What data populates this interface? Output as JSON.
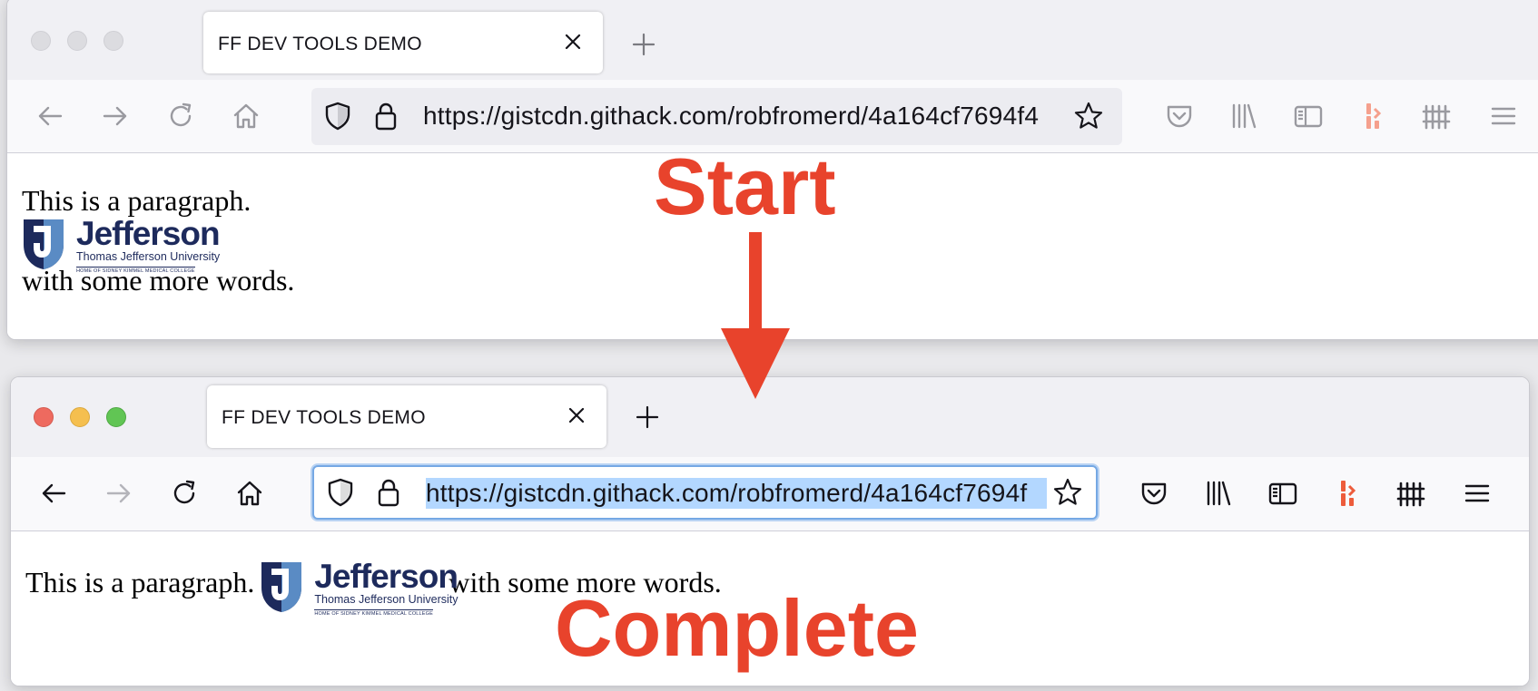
{
  "top_window": {
    "tab_title": "FF DEV TOOLS DEMO",
    "url": "https://gistcdn.githack.com/robfromerd/4a164cf7694f4",
    "paragraph_start": "This is a paragraph.",
    "paragraph_end": "with some more words."
  },
  "bottom_window": {
    "tab_title": "FF DEV TOOLS DEMO",
    "url": "https://gistcdn.githack.com/robfromerd/4a164cf7694f",
    "paragraph_start": "This is a paragraph.",
    "paragraph_end": "with some more words."
  },
  "logo": {
    "name": "Jefferson",
    "subtitle": "Thomas Jefferson University",
    "tagline": "HOME OF SIDNEY KIMMEL MEDICAL COLLEGE"
  },
  "annotations": {
    "start": "Start",
    "complete": "Complete"
  },
  "colors": {
    "annotation": "#e8432c",
    "logo_navy": "#1d2a5c",
    "url_selection": "#b3d7ff",
    "pocket_toolbar_icon": "#ed5c3b"
  },
  "icons": [
    "back-icon",
    "forward-icon",
    "reload-icon",
    "home-icon",
    "shield-icon",
    "lock-icon",
    "star-icon",
    "pocket-icon",
    "library-icon",
    "sidebar-icon",
    "extension-icon",
    "fence-icon",
    "menu-icon",
    "close-icon",
    "plus-icon"
  ]
}
